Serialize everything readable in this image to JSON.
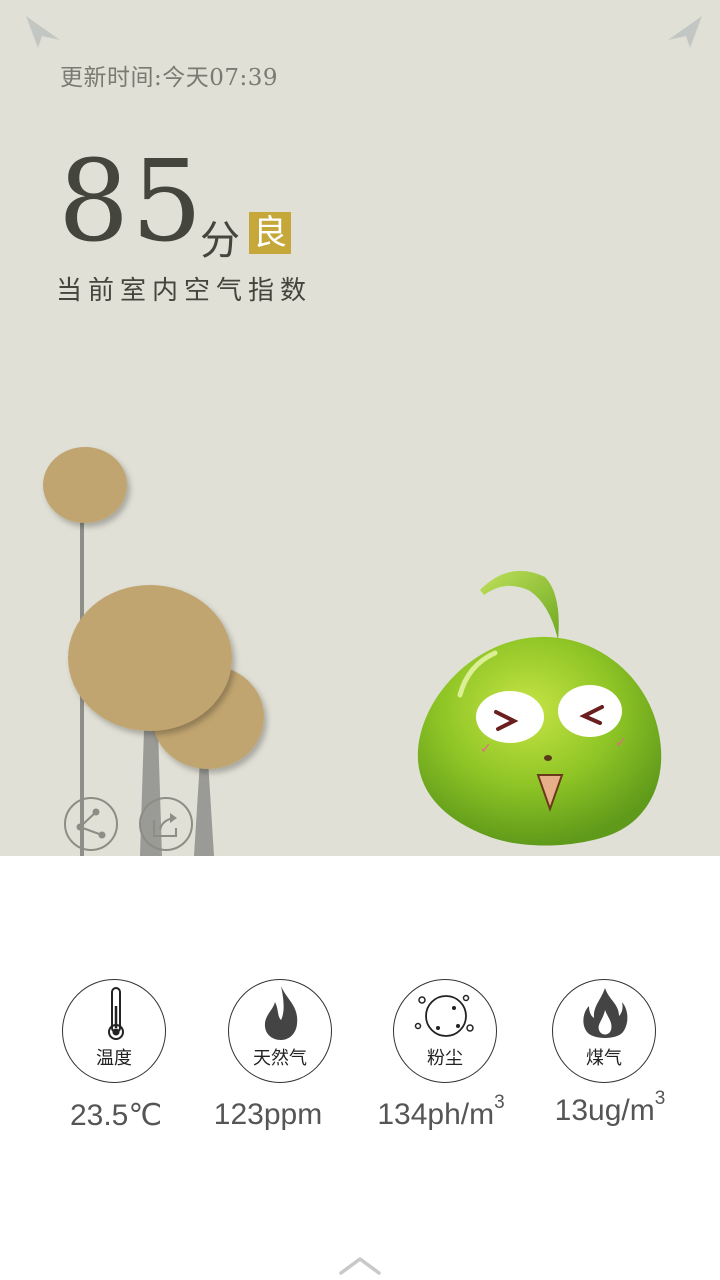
{
  "header": {
    "update_time": "更新时间:今天07:39"
  },
  "air_quality": {
    "score": "85",
    "score_unit": "分",
    "grade": "良",
    "label": "当前室内空气指数"
  },
  "actions": {
    "share_icon": "share-icon",
    "export_icon": "export-icon"
  },
  "sensors": [
    {
      "label": "温度",
      "icon": "thermometer-icon",
      "value": "23.5℃",
      "unit": "",
      "sup": ""
    },
    {
      "label": "天然气",
      "icon": "flame-icon",
      "value": "123ppm",
      "unit": "",
      "sup": ""
    },
    {
      "label": "粉尘",
      "icon": "dust-icon",
      "value": "134ph/m",
      "unit": "",
      "sup": "3"
    },
    {
      "label": "煤气",
      "icon": "gas-flame-icon",
      "value": "13ug/m",
      "unit": "",
      "sup": "3"
    }
  ],
  "colors": {
    "background_top": "#e0e0d6",
    "grade_badge": "#c6a73a",
    "text_dark": "#44453d",
    "tree": "#c1a570",
    "mascot": "#8fc526"
  },
  "footer": {
    "expand_icon": "chevron-up-icon"
  }
}
